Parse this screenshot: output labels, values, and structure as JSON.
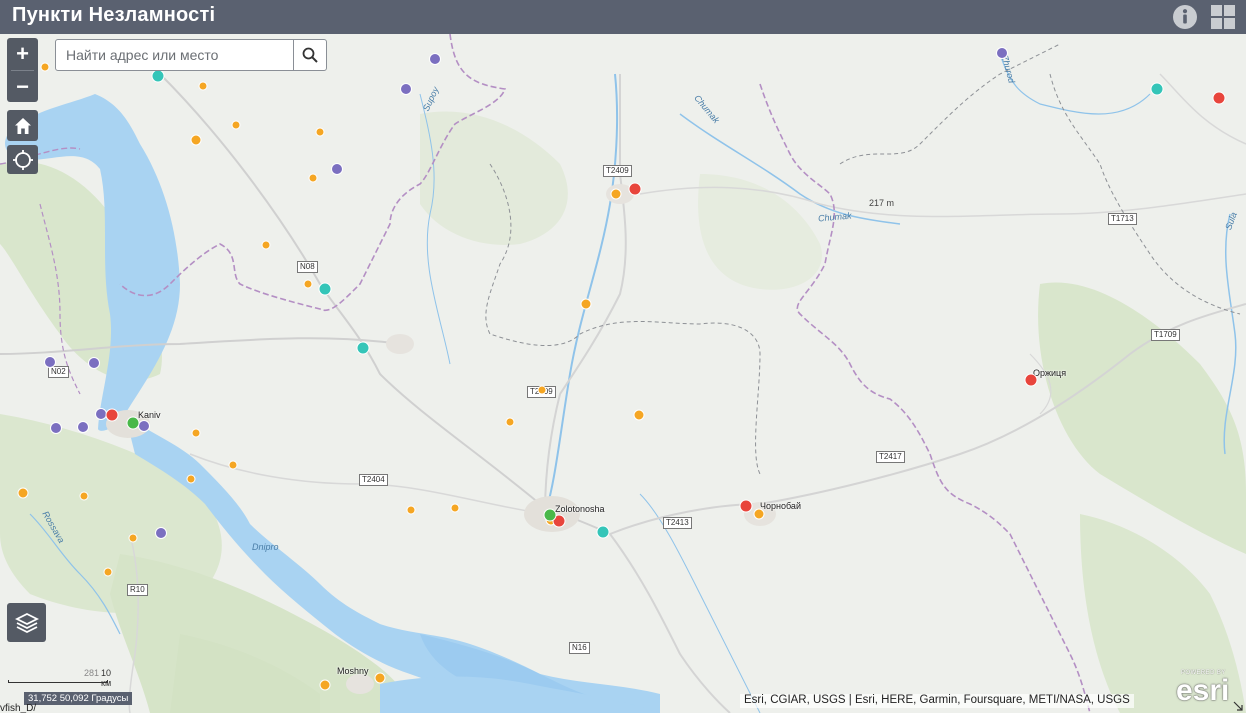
{
  "header": {
    "title": "Пункти Незламності",
    "bg_color": "#5a6170"
  },
  "search": {
    "placeholder": "Найти адрес или место"
  },
  "controls": {
    "zoom_in": "+",
    "zoom_out": "−",
    "icons": [
      "info-icon",
      "grid-icon",
      "home-icon",
      "locate-icon",
      "layers-icon",
      "search-icon"
    ]
  },
  "map": {
    "cities": [
      "Kaniv",
      "Zolotonosha",
      "Чорнобай",
      "Оржиця",
      "Moshny"
    ],
    "rivers": [
      "Supoy",
      "Chumak",
      "Chumak",
      "Dnipro",
      "Rossava",
      "Sula",
      "Zhurod"
    ],
    "roads": [
      "T2409",
      "N08",
      "N02",
      "T2409",
      "T2404",
      "T2413",
      "T2417",
      "T1713",
      "T1709",
      "R10",
      "N16"
    ],
    "elevation": "217 m",
    "marker_colors": {
      "heating": "#f5a623",
      "fuel": "#34c5b8",
      "shelter": "#7b6fc0",
      "medical": "#e8453c",
      "power": "#49b849"
    }
  },
  "scale": {
    "label": "10 км",
    "prefix": "281"
  },
  "coordinates": "31,752 50,092 Градусы",
  "bottom_left_text": "vfish_D/",
  "attribution": "Esri, CGIAR, USGS | Esri, HERE, Garmin, Foursquare, METI/NASA, USGS",
  "esri_logo": {
    "powered_by": "POWERED BY",
    "brand": "esri"
  }
}
